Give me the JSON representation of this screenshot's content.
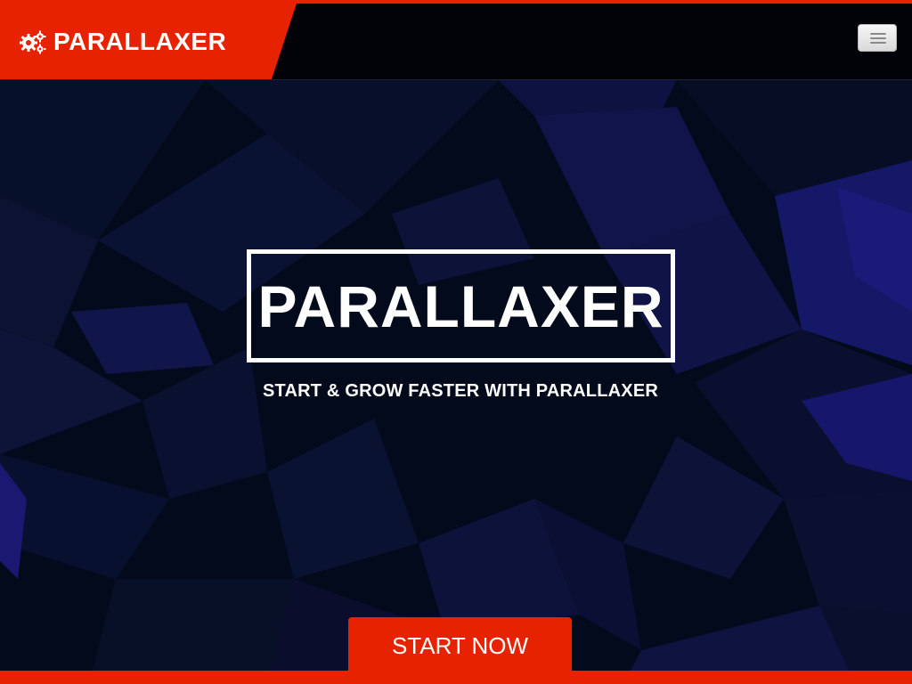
{
  "brand": {
    "name": "PARALLAXER",
    "icon": "gears-icon"
  },
  "nav": {
    "menu_toggle_icon": "hamburger-icon"
  },
  "hero": {
    "title": "PARALLAXER",
    "subtitle": "START & GROW FASTER WITH PARALLAXER",
    "cta_label": "START NOW"
  },
  "colors": {
    "accent": "#e62200",
    "navbar_bg": "#010308",
    "hero_bg": "#03091a",
    "hero_polygons": "#1a1a6e",
    "text": "#ffffff"
  }
}
